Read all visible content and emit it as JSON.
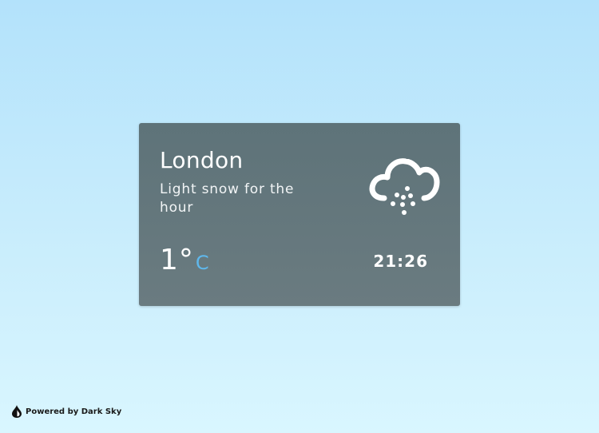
{
  "weather": {
    "city": "London",
    "summary": "Light snow for the hour",
    "icon": "snow-cloud-icon",
    "temperature": "1°",
    "unit": "C",
    "time": "21:26"
  },
  "footer": {
    "powered_by": "Powered by Dark Sky",
    "logo_icon": "dark-sky-logo-icon"
  },
  "colors": {
    "card_background": "#637579",
    "unit_accent": "#5fb8ec",
    "page_gradient_top": "#b3e2fb",
    "page_gradient_bottom": "#d9f6ff"
  }
}
